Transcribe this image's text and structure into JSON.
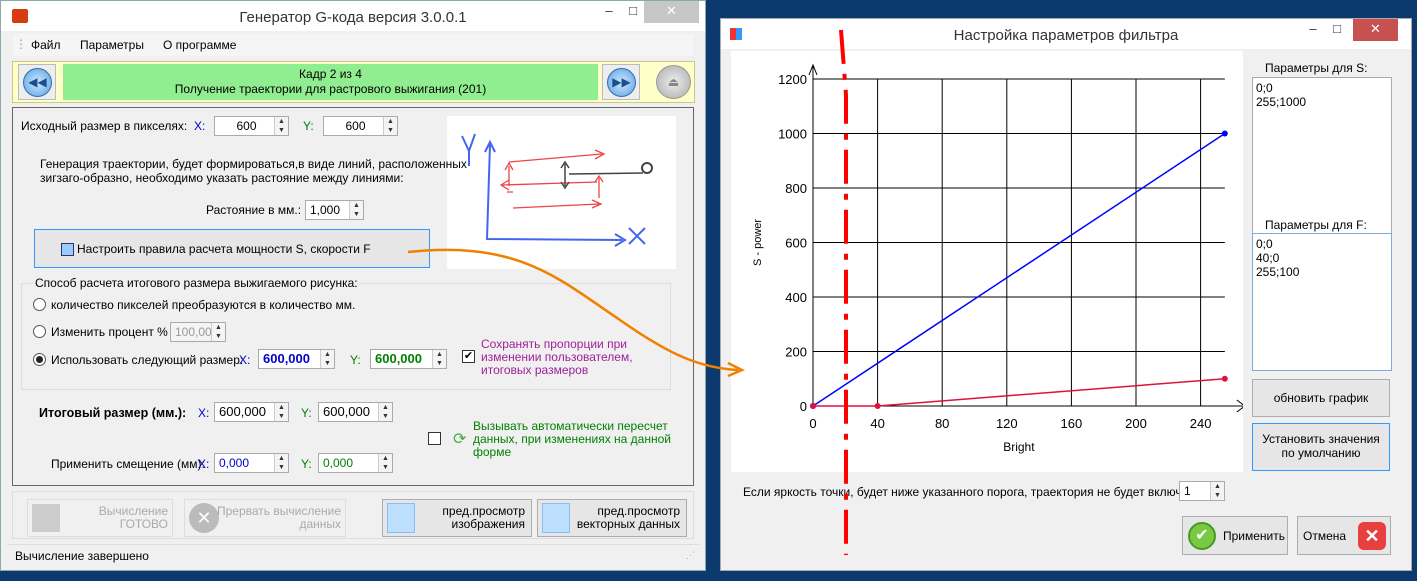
{
  "main_window": {
    "title": "Генератор G-кода версия 3.0.0.1",
    "menu": [
      "Файл",
      "Параметры",
      "О программе"
    ],
    "nav": {
      "line1": "Кадр 2 из 4",
      "line2": "Получение траектории для растрового выжигания (201)"
    },
    "source_size": {
      "label": "Исходный размер в пикселях:",
      "x_label": "X:",
      "x": "600",
      "y_label": "Y:",
      "y": "600"
    },
    "description": [
      "Генерация траектории, будет формироваться,в виде линий, расположенных",
      "зигзаго-образно,  необходимо указать растояние между линиями:"
    ],
    "distance": {
      "label": "Растояние в мм.:",
      "value": "1,000"
    },
    "configure_button": "Настроить правила расчета мощности S, скорости F",
    "sketch_labels": {
      "y": "Y",
      "x": "X"
    },
    "group": {
      "title": "Способ расчета итогового размера выжигаемого рисунка:",
      "radio1": "количество пикселей преобразуются в количество мм.",
      "radio2": "Изменить процент %",
      "percent": "100,00",
      "radio3": "Использовать следующий размер:",
      "x_label": "X:",
      "x": "600,000",
      "y_label": "Y:",
      "y": "600,000",
      "keep_proportions": [
        "Сохранять пропорции при",
        "изменении пользователем,",
        "итоговых размеров"
      ],
      "selected": 3,
      "keep_checked": true
    },
    "final_size": {
      "label": "Итоговый размер (мм.):",
      "x_label": "X:",
      "x": "600,000",
      "y_label": "Y:",
      "y": "600,000"
    },
    "auto_recalc": {
      "text": [
        "Вызывать автоматически пересчет",
        "данных, при изменениях на данной",
        "форме"
      ],
      "checked": false
    },
    "offset": {
      "label": "Применить смещение (мм):",
      "x_label": "X:",
      "x": "0,000",
      "y_label": "Y:",
      "y": "0,000"
    },
    "buttons": {
      "calc": [
        "Вычисление",
        "ГОТОВО"
      ],
      "abort": [
        "Прервать вычисление",
        "данных"
      ],
      "preview_image": [
        "пред.просмотр",
        "изображения"
      ],
      "preview_vector": [
        "пред.просмотр",
        "векторных данных"
      ]
    },
    "status": "Вычисление завершено"
  },
  "dialog": {
    "title": "Настройка параметров фильтра",
    "s_label": "Параметры для S:",
    "s_params": "0;0\n255;1000",
    "f_label": "Параметры для F:",
    "f_params": "0;0\n40;0\n255;100",
    "refresh_button": "обновить график",
    "defaults_button": "Установить значения по умолчанию",
    "threshold_label": "Если яркость точки, будет ниже указанного порога, траектория не будет включена:",
    "threshold": "1",
    "apply_button": "Применить",
    "cancel_button": "Отмена"
  },
  "chart_data": {
    "type": "line",
    "xlabel": "Bright",
    "ylabel": "S - power",
    "xlim": [
      0,
      255
    ],
    "ylim": [
      0,
      1200
    ],
    "xticks": [
      "0",
      "40",
      "80",
      "120",
      "160",
      "200",
      "240"
    ],
    "yticks": [
      "0",
      "200",
      "400",
      "600",
      "800",
      "1000",
      "1200"
    ],
    "grid": true,
    "series": [
      {
        "color": "#0000ff",
        "points": [
          [
            0,
            0
          ],
          [
            255,
            1000
          ]
        ]
      },
      {
        "color": "#dc143c",
        "points": [
          [
            0,
            0
          ],
          [
            40,
            0
          ],
          [
            255,
            100
          ]
        ]
      }
    ]
  },
  "colors": {
    "nav_green": "#90ee90",
    "nav_bg": "#ffffc8",
    "x_blue": "#0000cc",
    "y_green": "#008000",
    "purple": "#a0209a",
    "annotation_red": "#ff0000",
    "annotation_orange": "#f08000"
  }
}
